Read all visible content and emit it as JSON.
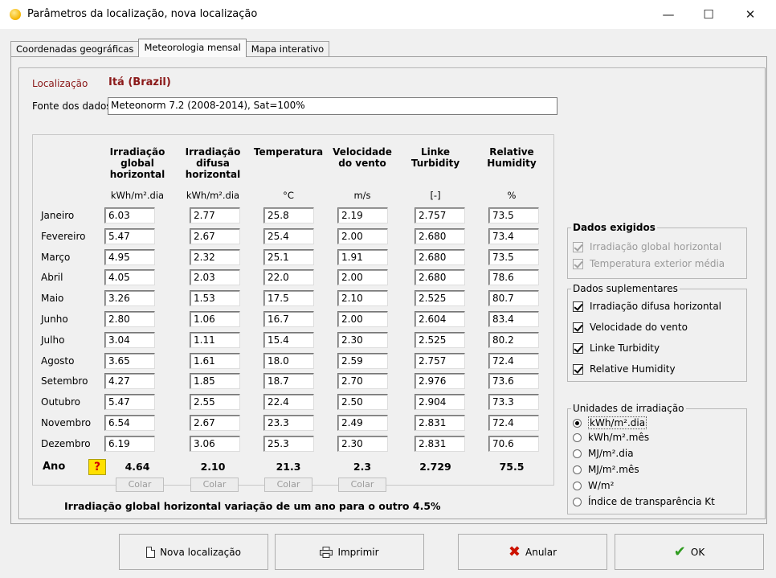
{
  "window": {
    "title": "Parâmetros da localização, nova localização",
    "controls": {
      "minimize": "—",
      "maximize": "☐",
      "close": "✕"
    }
  },
  "tabs": [
    {
      "label": "Coordenadas geográficas",
      "active": false
    },
    {
      "label": "Meteorologia mensal",
      "active": true
    },
    {
      "label": "Mapa interativo",
      "active": false
    }
  ],
  "location": {
    "label": "Localização",
    "value": "Itá  (Brazil)"
  },
  "source": {
    "label": "Fonte dos dados",
    "value": "Meteonorm 7.2 (2008-2014), Sat=100%"
  },
  "table": {
    "columns": [
      {
        "header": "Irradiação global horizontal",
        "unit": "kWh/m².dia"
      },
      {
        "header": "Irradiação difusa horizontal",
        "unit": "kWh/m².dia"
      },
      {
        "header": "Temperatura",
        "unit": "°C"
      },
      {
        "header": "Velocidade do vento",
        "unit": "m/s"
      },
      {
        "header": "Linke Turbidity",
        "unit": "[-]"
      },
      {
        "header": "Relative Humidity",
        "unit": "%"
      }
    ],
    "rows": [
      {
        "month": "Janeiro",
        "values": [
          "6.03",
          "2.77",
          "25.8",
          "2.19",
          "2.757",
          "73.5"
        ]
      },
      {
        "month": "Fevereiro",
        "values": [
          "5.47",
          "2.67",
          "25.4",
          "2.00",
          "2.680",
          "73.4"
        ]
      },
      {
        "month": "Março",
        "values": [
          "4.95",
          "2.32",
          "25.1",
          "1.91",
          "2.680",
          "73.5"
        ]
      },
      {
        "month": "Abril",
        "values": [
          "4.05",
          "2.03",
          "22.0",
          "2.00",
          "2.680",
          "78.6"
        ]
      },
      {
        "month": "Maio",
        "values": [
          "3.26",
          "1.53",
          "17.5",
          "2.10",
          "2.525",
          "80.7"
        ]
      },
      {
        "month": "Junho",
        "values": [
          "2.80",
          "1.06",
          "16.7",
          "2.00",
          "2.604",
          "83.4"
        ]
      },
      {
        "month": "Julho",
        "values": [
          "3.04",
          "1.11",
          "15.4",
          "2.30",
          "2.525",
          "80.2"
        ]
      },
      {
        "month": "Agosto",
        "values": [
          "3.65",
          "1.61",
          "18.0",
          "2.59",
          "2.757",
          "72.4"
        ]
      },
      {
        "month": "Setembro",
        "values": [
          "4.27",
          "1.85",
          "18.7",
          "2.70",
          "2.976",
          "73.6"
        ]
      },
      {
        "month": "Outubro",
        "values": [
          "5.47",
          "2.55",
          "22.4",
          "2.50",
          "2.904",
          "73.3"
        ]
      },
      {
        "month": "Novembro",
        "values": [
          "6.54",
          "2.67",
          "23.3",
          "2.49",
          "2.831",
          "72.4"
        ]
      },
      {
        "month": "Dezembro",
        "values": [
          "6.19",
          "3.06",
          "25.3",
          "2.30",
          "2.831",
          "70.6"
        ]
      }
    ],
    "annual_label": "Ano",
    "annual": [
      "4.64",
      "2.10",
      "21.3",
      "2.3",
      "2.729",
      "75.5"
    ],
    "paste_label": "Colar",
    "help_symbol": "?"
  },
  "variation_note": "Irradiação global horizontal variação de um ano para o outro  4.5%",
  "required_group": {
    "title": "Dados exigidos",
    "items": [
      {
        "label": "Irradiação global horizontal",
        "checked": true
      },
      {
        "label": "Temperatura exterior média",
        "checked": true
      }
    ]
  },
  "supplementary_group": {
    "title": "Dados suplementares",
    "items": [
      {
        "label": "Irradiação difusa horizontal",
        "checked": true
      },
      {
        "label": "Velocidade do vento",
        "checked": true
      },
      {
        "label": "Linke Turbidity",
        "checked": true
      },
      {
        "label": "Relative Humidity",
        "checked": true
      }
    ]
  },
  "units_group": {
    "title": "Unidades de irradiação",
    "options": [
      {
        "label": "kWh/m².dia",
        "selected": true
      },
      {
        "label": "kWh/m².mês",
        "selected": false
      },
      {
        "label": "MJ/m².dia",
        "selected": false
      },
      {
        "label": "MJ/m².mês",
        "selected": false
      },
      {
        "label": "W/m²",
        "selected": false
      },
      {
        "label": "Índice de transparência Kt",
        "selected": false
      }
    ]
  },
  "buttons": {
    "new_location": "Nova localização",
    "print": "Imprimir",
    "cancel": "Anular",
    "ok": "OK"
  },
  "colors": {
    "location_red": "#8b1a1a",
    "cancel_red": "#cc1100",
    "ok_green": "#2e9b1e",
    "help_yellow": "#ffe000"
  }
}
